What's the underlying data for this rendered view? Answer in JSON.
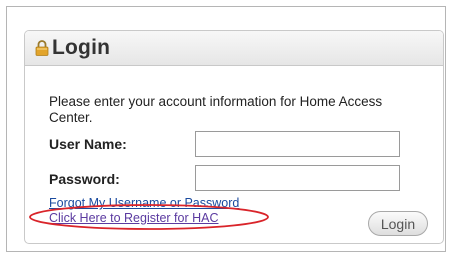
{
  "login": {
    "title": "Login",
    "lock_icon": "padlock-icon",
    "instructions": "Please enter your account information for Home Access Center.",
    "username_label": "User Name:",
    "username_value": "",
    "password_label": "Password:",
    "password_value": "",
    "forgot_link": "Forgot My Username or Password",
    "register_link": "Click Here to Register for HAC",
    "login_button": "Login"
  },
  "colors": {
    "link_blue": "#1a4a9e",
    "link_visited": "#5b3aa0",
    "highlight_ellipse": "#d9242a",
    "lock_gold": "#e2a42b"
  }
}
